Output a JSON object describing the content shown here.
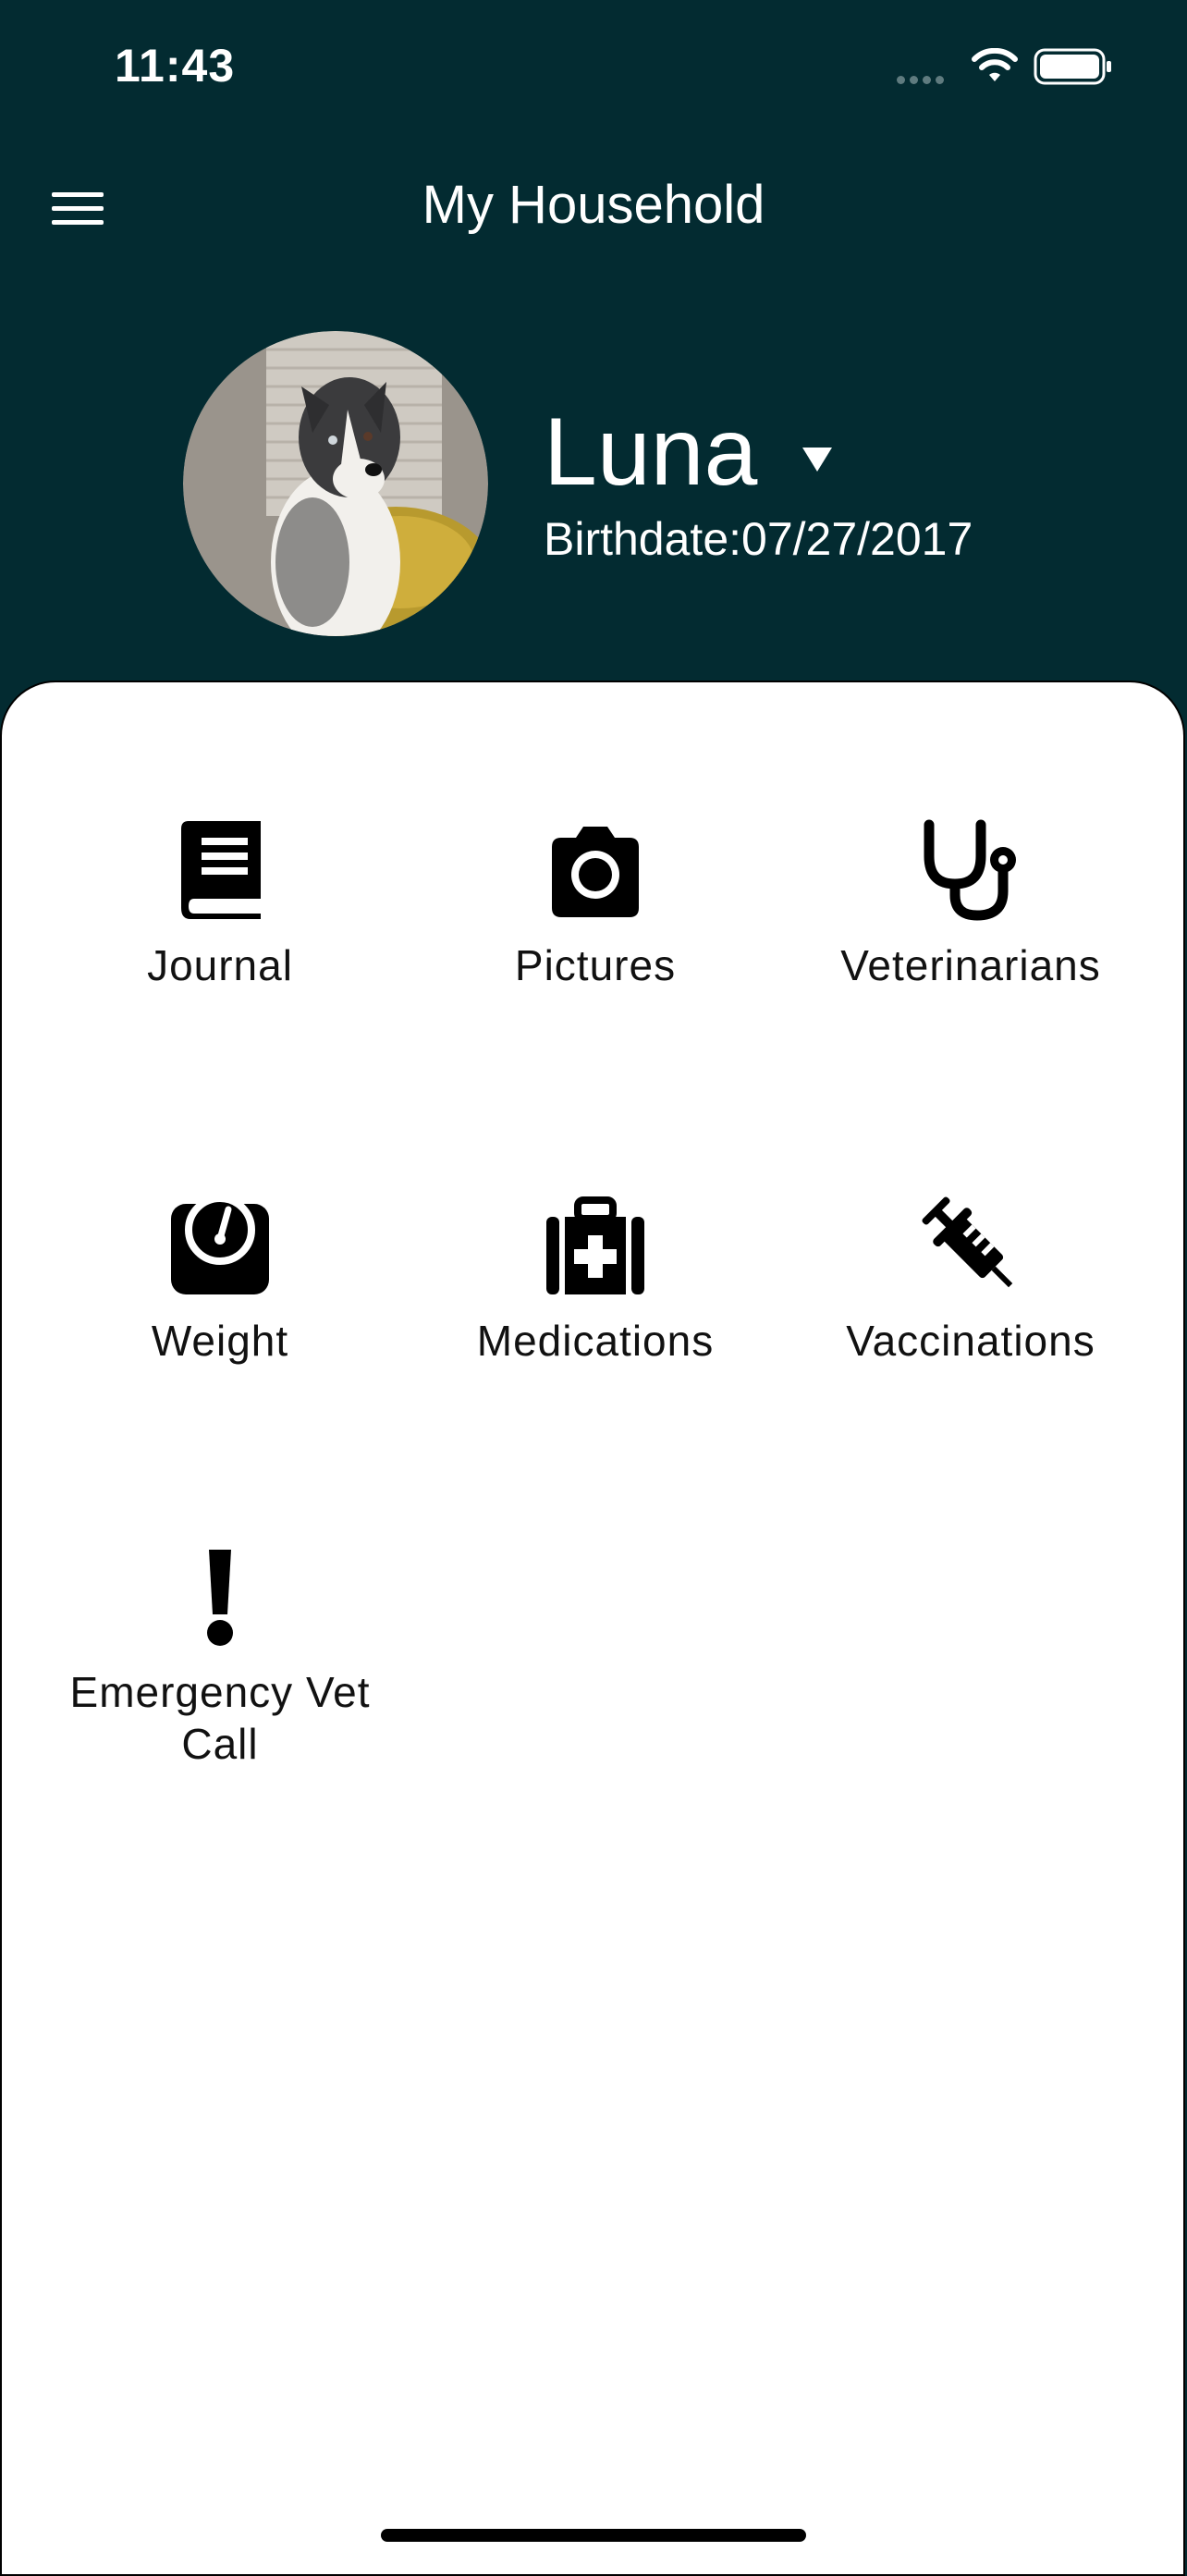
{
  "status_bar": {
    "time": "11:43"
  },
  "nav": {
    "title": "My Household",
    "menu_icon": "menu-icon"
  },
  "pet": {
    "name": "Luna",
    "birthdate": "Birthdate:07/27/2017",
    "photo": "dog-photo"
  },
  "menu_tiles": [
    {
      "label": "Journal",
      "icon": "journal-icon"
    },
    {
      "label": "Pictures",
      "icon": "camera-icon"
    },
    {
      "label": "Veterinarians",
      "icon": "stethoscope-icon"
    },
    {
      "label": "Weight",
      "icon": "scale-icon"
    },
    {
      "label": "Medications",
      "icon": "medical-kit-icon"
    },
    {
      "label": "Vaccinations",
      "icon": "syringe-icon"
    },
    {
      "label": "Emergency Vet Call",
      "icon": "exclamation-icon"
    }
  ],
  "colors": {
    "header_bg": "#032b31",
    "card_bg": "#ffffff",
    "text_dark": "#111111"
  }
}
